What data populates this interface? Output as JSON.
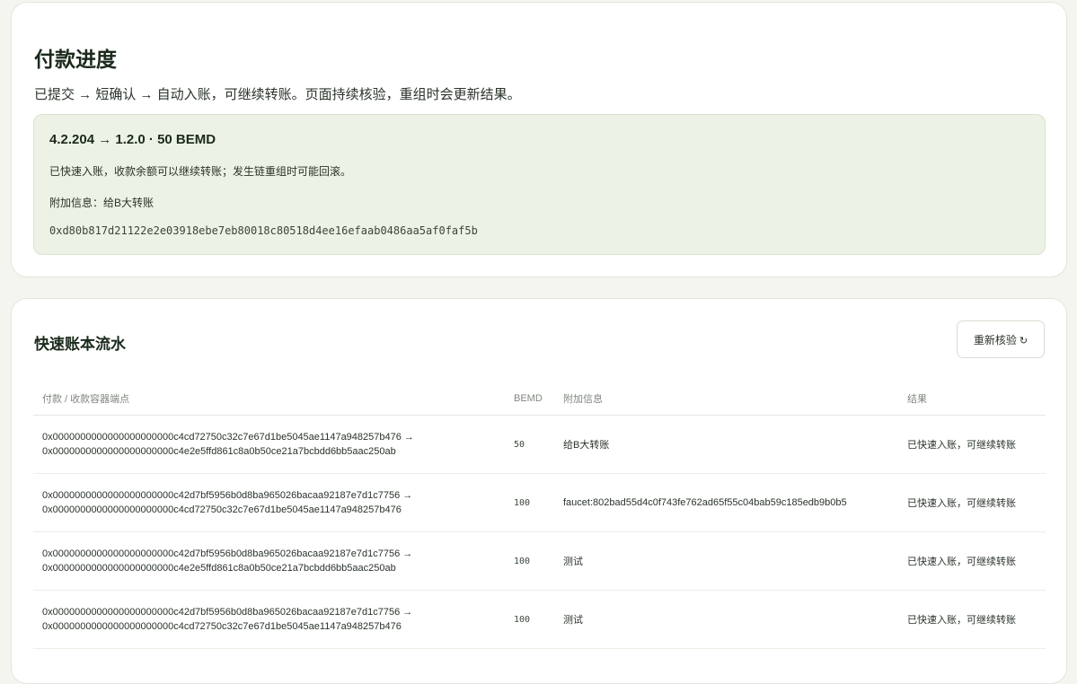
{
  "progress": {
    "title": "付款进度",
    "description": "已提交 → 短确认 → 自动入账，可继续转账。页面持续核验，重组时会更新结果。",
    "status": {
      "summary": "4.2.204 → 1.2.0 · 50 BEMD",
      "message": "已快速入账，收款余额可以继续转账；发生链重组时可能回滚。",
      "memo": "附加信息：给B大转账",
      "hash": "0xd80b817d21122e2e03918ebe7eb80018c80518d4ee16efaab0486aa5af0faf5b"
    }
  },
  "ledger": {
    "title": "快速账本流水",
    "reverify_label": "重新核验",
    "reverify_icon": "refresh-icon",
    "columns": [
      "付款 / 收款容器端点",
      "BEMD",
      "附加信息",
      "结果"
    ],
    "rows": [
      {
        "from": "0x0000000000000000000000c4cd72750c32c7e67d1be5045ae1147a948257b476 →",
        "to": "0x0000000000000000000000c4e2e5ffd861c8a0b50ce21a7bcbdd6bb5aac250ab",
        "amount": "50",
        "memo": "给B大转账",
        "result": "已快速入账，可继续转账"
      },
      {
        "from": "0x0000000000000000000000c42d7bf5956b0d8ba965026bacaa92187e7d1c7756 →",
        "to": "0x0000000000000000000000c4cd72750c32c7e67d1be5045ae1147a948257b476",
        "amount": "100",
        "memo": "faucet:802bad55d4c0f743fe762ad65f55c04bab59c185edb9b0b5",
        "result": "已快速入账，可继续转账"
      },
      {
        "from": "0x0000000000000000000000c42d7bf5956b0d8ba965026bacaa92187e7d1c7756 →",
        "to": "0x0000000000000000000000c4e2e5ffd861c8a0b50ce21a7bcbdd6bb5aac250ab",
        "amount": "100",
        "memo": "测试",
        "result": "已快速入账，可继续转账"
      },
      {
        "from": "0x0000000000000000000000c42d7bf5956b0d8ba965026bacaa92187e7d1c7756 →",
        "to": "0x0000000000000000000000c4cd72750c32c7e67d1be5045ae1147a948257b476",
        "amount": "100",
        "memo": "测试",
        "result": "已快速入账，可继续转账"
      }
    ]
  }
}
